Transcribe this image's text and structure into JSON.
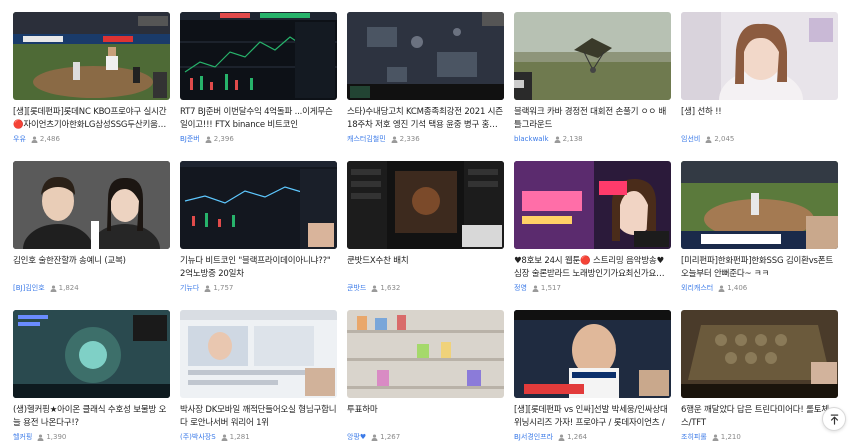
{
  "cards": [
    {
      "title": "[생][롯데펀파]롯데NC KBO프로야구 실시간🔴자이언츠기아한화LG삼성SSG두산키움KT엔...",
      "channel": "우유",
      "viewers": "2,486",
      "thumb": "thumb-baseball"
    },
    {
      "title": "RT7 BJ준버 이번달수익 4억돌파 ...이게무슨일이고!!! FTX binance 비트코인",
      "channel": "BJ준버",
      "viewers": "2,396",
      "thumb": "thumb-trading"
    },
    {
      "title": "스타)수내당고치 KCM종족최강전 2021 시즌18주차 저호 엥진 기석 택용 윤중 병구 홍규 상...",
      "channel": "캐스터김철민",
      "viewers": "2,336",
      "thumb": "thumb-starcraft"
    },
    {
      "title": "블랙워크 카바 경정전 대회전 손풀기 ㅇㅇ 배틀그라운드",
      "channel": "blackwalk",
      "viewers": "2,138",
      "thumb": "thumb-pubg"
    },
    {
      "title": "[생] 선하 !!",
      "channel": "임선비",
      "viewers": "2,045",
      "thumb": "thumb-streamer"
    },
    {
      "title": "김인호 술한잔할까 송예니 (교복)",
      "channel": "[BJ]김인호",
      "viewers": "1,824",
      "thumb": "thumb-couple"
    },
    {
      "title": "기뉴다 비트코인 \"블랙프라이데이아니냐??\" 2억노방중 20일차",
      "channel": "기뉴다",
      "viewers": "1,757",
      "thumb": "thumb-trading2"
    },
    {
      "title": "쿤밧드X수찬 배치",
      "channel": "쿤밧드",
      "viewers": "1,632",
      "thumb": "thumb-lol"
    },
    {
      "title": "♥8호보 24시 웹툰🔴 스트리밍 음악방송♥심장 술론받라드 노래방인기가요최신가요음방...",
      "channel": "정영",
      "viewers": "1,517",
      "thumb": "thumb-karaoke"
    },
    {
      "title": "[미리펀파]한화펀파]한화SSG 김이환vs폰트 오늘부터 안뻐준다~ ㅋㅋ",
      "channel": "외리캐스터",
      "viewers": "1,406",
      "thumb": "thumb-baseball2"
    },
    {
      "title": "(생)헬커핑★아이온 클래식 수호성 보물방 오늘 용전 나온다구!?",
      "channel": "헬커핑",
      "viewers": "1,390",
      "thumb": "thumb-aion"
    },
    {
      "title": "박사장 DK모바일 깨적단들어오실 형님구합니다 로안나서버 워리어 1위",
      "channel": "(주)박사장S",
      "viewers": "1,281",
      "thumb": "thumb-mobile"
    },
    {
      "title": "투표하마",
      "channel": "앙팡♥",
      "viewers": "1,267",
      "thumb": "thumb-shelf"
    },
    {
      "title": "[생][롯데펀파 vs 인싸]선발 박세웅/인싸상대 위닝시리즈 가자! 프로야구 / 롯데자이언츠 /",
      "channel": "BJ서경인프라",
      "viewers": "1,264",
      "thumb": "thumb-baseball3"
    },
    {
      "title": "6행운 깨달았다 답은 트린다미어다! 롤토체스/TFT",
      "channel": "조히피롤",
      "viewers": "1,210",
      "thumb": "thumb-tft"
    }
  ]
}
